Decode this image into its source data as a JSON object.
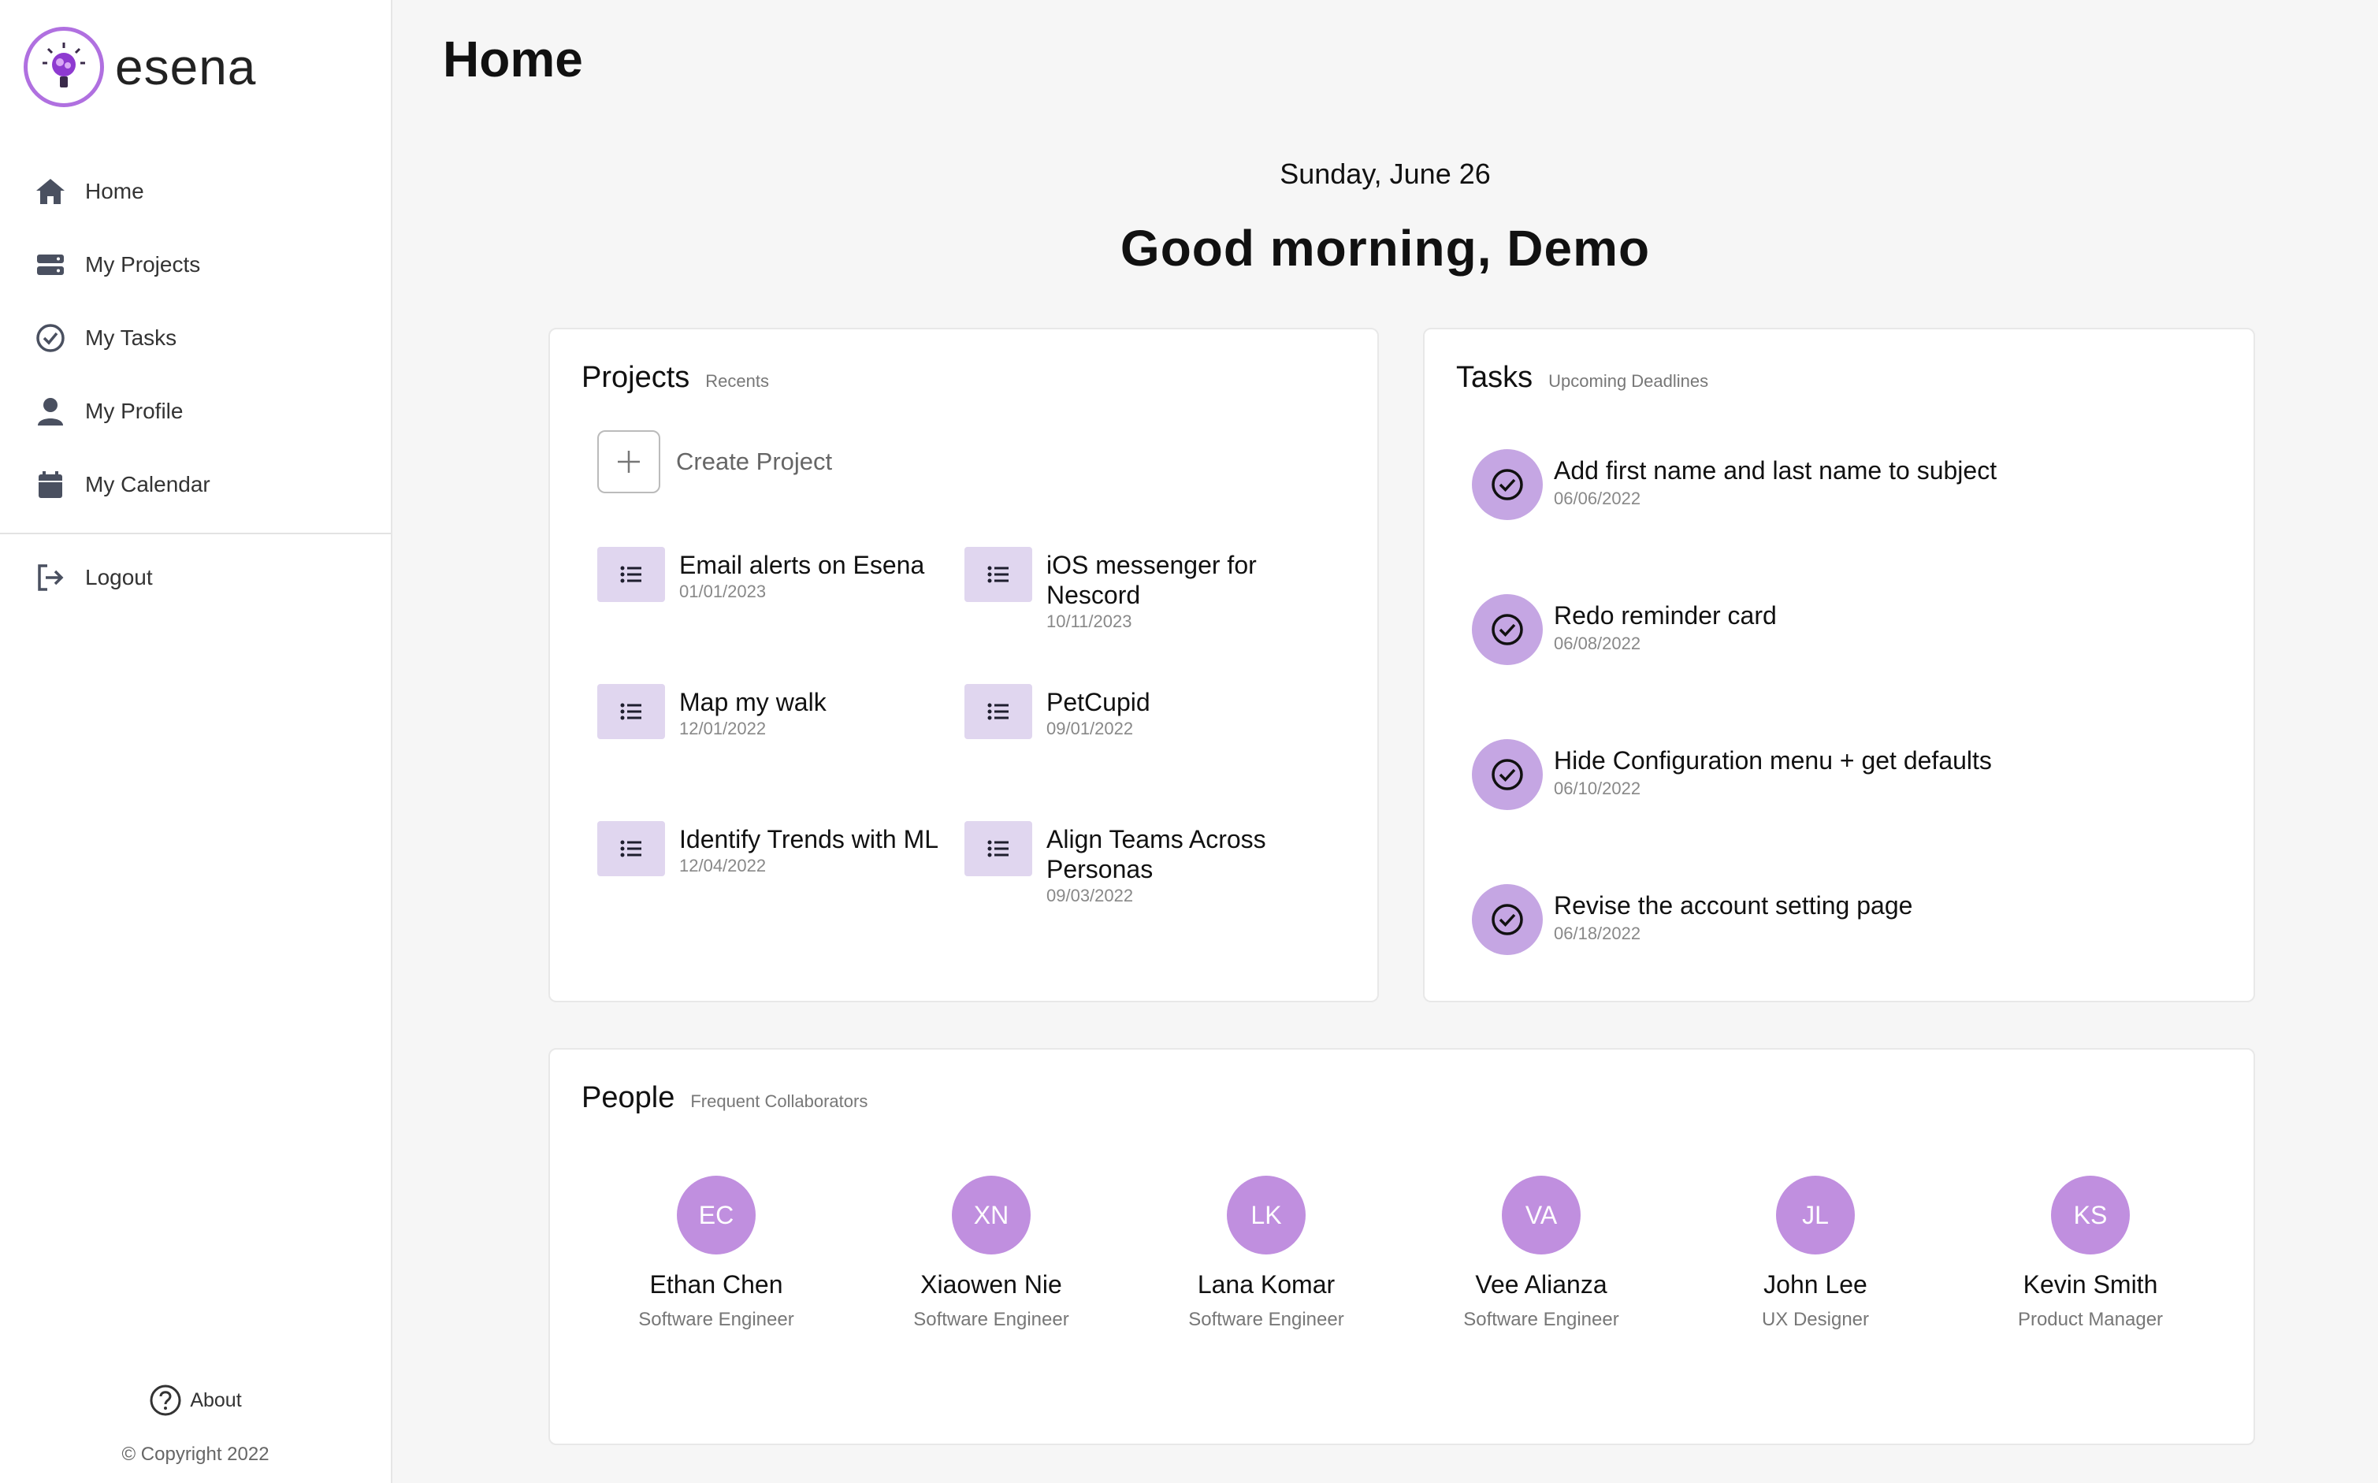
{
  "brand": {
    "name": "esena"
  },
  "nav": {
    "items": [
      {
        "label": "Home",
        "icon": "home-icon"
      },
      {
        "label": "My Projects",
        "icon": "projects-icon"
      },
      {
        "label": "My Tasks",
        "icon": "check-circle-icon"
      },
      {
        "label": "My Profile",
        "icon": "user-icon"
      },
      {
        "label": "My Calendar",
        "icon": "calendar-icon"
      }
    ],
    "logout": "Logout",
    "about": "About",
    "copyright": "© Copyright 2022"
  },
  "page": {
    "title": "Home",
    "date": "Sunday, June 26",
    "greeting": "Good morning, Demo"
  },
  "projects": {
    "title": "Projects",
    "subtitle": "Recents",
    "create_label": "Create Project",
    "items": [
      {
        "name": "Email alerts on Esena",
        "date": "01/01/2023"
      },
      {
        "name": "iOS messenger for Nescord",
        "date": "10/11/2023"
      },
      {
        "name": "Map my walk",
        "date": "12/01/2022"
      },
      {
        "name": "PetCupid",
        "date": "09/01/2022"
      },
      {
        "name": "Identify Trends with ML",
        "date": "12/04/2022"
      },
      {
        "name": "Align Teams Across Personas",
        "date": "09/03/2022"
      }
    ]
  },
  "tasks": {
    "title": "Tasks",
    "subtitle": "Upcoming Deadlines",
    "items": [
      {
        "name": "Add first name and last name to subject",
        "date": "06/06/2022"
      },
      {
        "name": "Redo reminder card",
        "date": "06/08/2022"
      },
      {
        "name": "Hide Configuration menu + get defaults",
        "date": "06/10/2022"
      },
      {
        "name": "Revise the account setting page",
        "date": "06/18/2022"
      }
    ]
  },
  "people": {
    "title": "People",
    "subtitle": "Frequent Collaborators",
    "items": [
      {
        "initials": "EC",
        "name": "Ethan Chen",
        "role": "Software Engineer"
      },
      {
        "initials": "XN",
        "name": "Xiaowen Nie",
        "role": "Software Engineer"
      },
      {
        "initials": "LK",
        "name": "Lana Komar",
        "role": "Software Engineer"
      },
      {
        "initials": "VA",
        "name": "Vee Alianza",
        "role": "Software Engineer"
      },
      {
        "initials": "JL",
        "name": "John Lee",
        "role": "UX Designer"
      },
      {
        "initials": "KS",
        "name": "Kevin Smith",
        "role": "Product Manager"
      }
    ]
  },
  "colors": {
    "accent": "#c08fdf",
    "task_circle": "#c5a6e3",
    "project_icon_bg": "#e0d6ef",
    "nav_icon": "#4a5060"
  }
}
